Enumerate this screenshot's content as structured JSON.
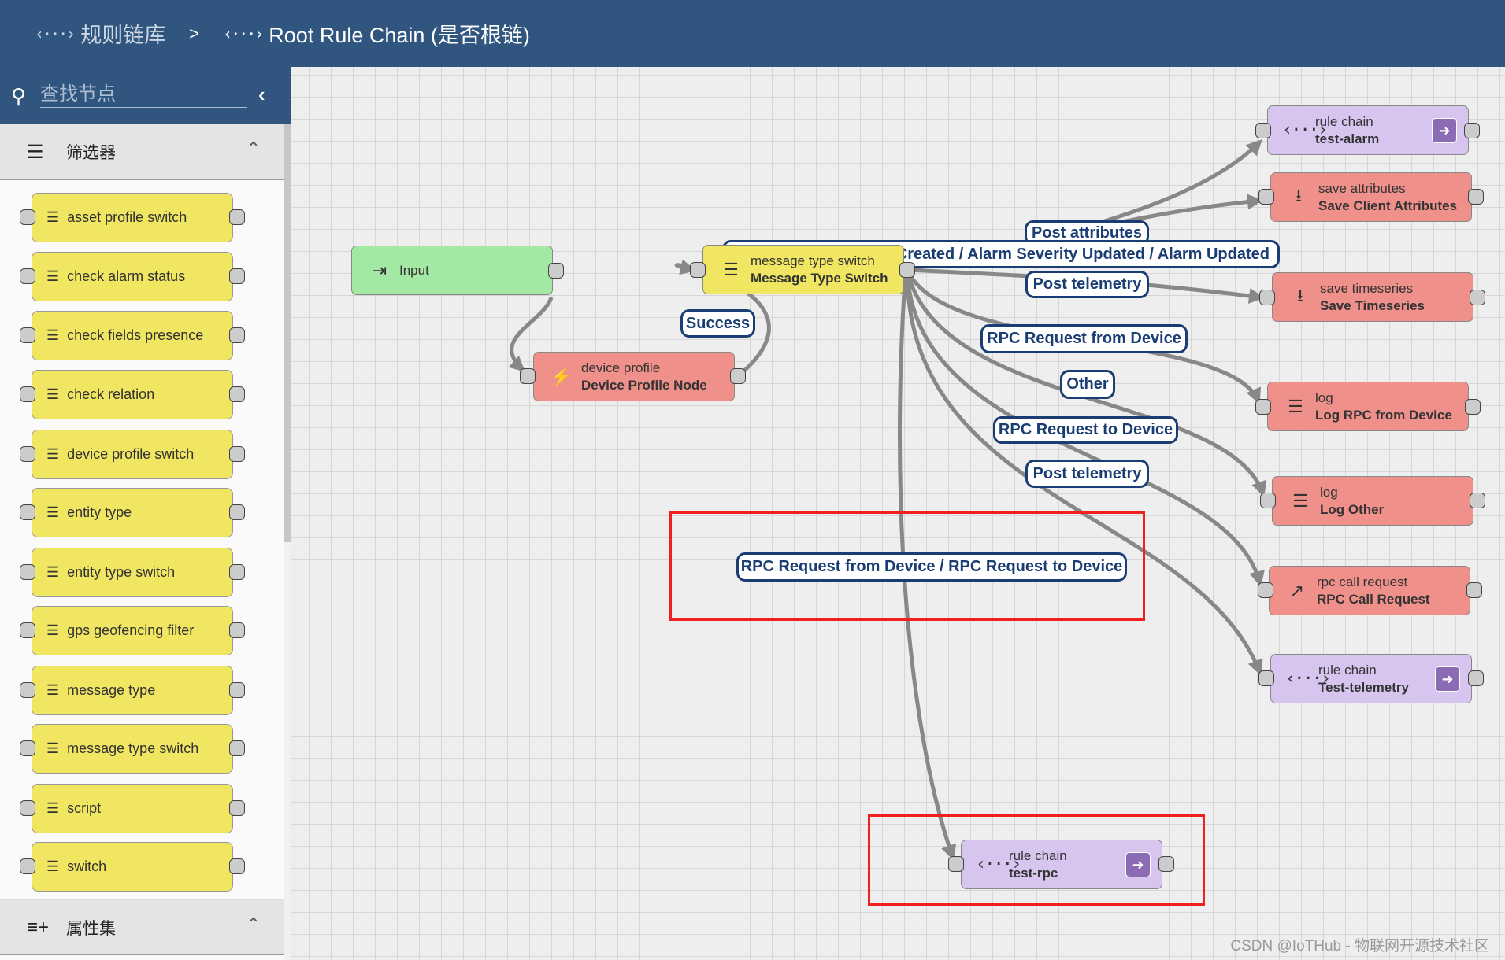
{
  "header": {
    "breadcrumb": [
      {
        "label": "规则链库",
        "icon": "rule-chain-icon"
      },
      {
        "label": "Root Rule Chain (是否根链)",
        "icon": "rule-chain-icon"
      }
    ],
    "separator": ">"
  },
  "sidebar": {
    "search_placeholder": "查找节点",
    "sections": [
      {
        "title": "筛选器",
        "icon": "filter-icon",
        "expanded": true
      },
      {
        "title": "属性集",
        "icon": "playlist-add-icon",
        "expanded": true
      }
    ],
    "filter_items": [
      "asset profile switch",
      "check alarm status",
      "check fields presence",
      "check relation",
      "device profile switch",
      "entity type",
      "entity type switch",
      "gps geofencing filter",
      "message type",
      "message type switch",
      "script",
      "switch"
    ]
  },
  "nodes": {
    "input": {
      "name": "Input"
    },
    "device_profile": {
      "type": "device profile",
      "name": "Device Profile Node"
    },
    "msg_switch": {
      "type": "message type switch",
      "name": "Message Type Switch"
    },
    "test_alarm": {
      "type": "rule chain",
      "name": "test-alarm"
    },
    "save_attrs": {
      "type": "save attributes",
      "name": "Save Client Attributes"
    },
    "save_ts": {
      "type": "save timeseries",
      "name": "Save Timeseries"
    },
    "log_rpc": {
      "type": "log",
      "name": "Log RPC from Device"
    },
    "log_other": {
      "type": "log",
      "name": "Log Other"
    },
    "rpc_call": {
      "type": "rpc call request",
      "name": "RPC Call Request"
    },
    "test_telemetry": {
      "type": "rule chain",
      "name": "Test-telemetry"
    },
    "test_rpc": {
      "type": "rule chain",
      "name": "test-rpc"
    }
  },
  "edge_labels": {
    "success": "Success",
    "post_attributes": "Post attributes",
    "alarm": "Created / Alarm Severity Updated / Alarm Updated",
    "post_telemetry_1": "Post telemetry",
    "rpc_from": "RPC Request from Device",
    "other": "Other",
    "rpc_to": "RPC Request to Device",
    "post_telemetry_2": "Post telemetry",
    "rpc_both": "RPC Request from Device / RPC Request to Device"
  },
  "colors": {
    "header": "#305680",
    "filter_node": "#f0e662",
    "action_node": "#f0908a",
    "rule_chain_node": "#d7c5f0",
    "input_node": "#a3e8a3",
    "label_border": "#1a3d73",
    "highlight": "#f02020"
  },
  "watermark": "CSDN @IoTHub - 物联网开源技术社区"
}
